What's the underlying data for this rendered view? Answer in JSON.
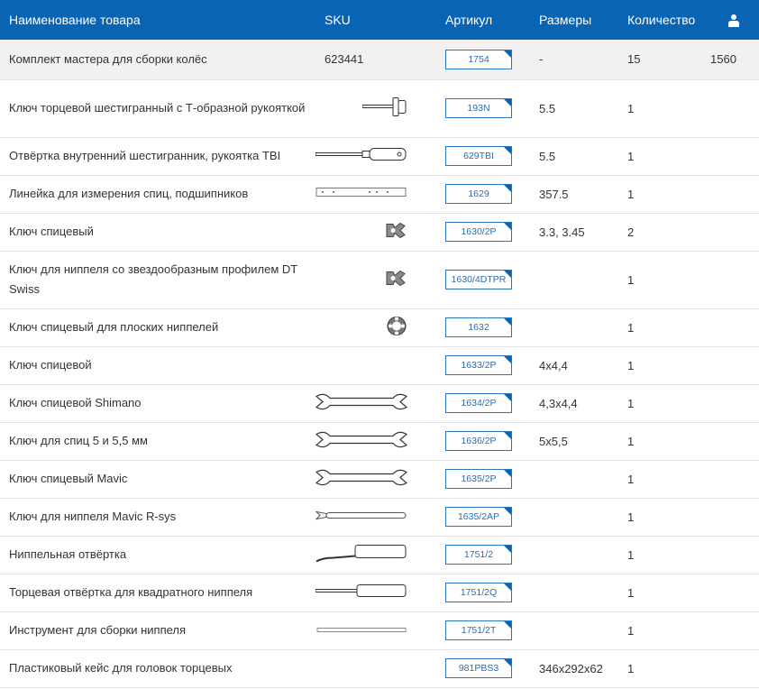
{
  "header": {
    "name": "Наименование товара",
    "sku": "SKU",
    "article": "Артикул",
    "size": "Размеры",
    "qty": "Количество",
    "user_icon": "user-icon"
  },
  "rows": [
    {
      "name": "Комплект мастера для сборки колёс",
      "sku": "623441",
      "article": "1754",
      "size": "-",
      "qty": "15",
      "extra": "1560",
      "image": ""
    },
    {
      "name": "Ключ торцевой шестигранный с Т-образной рукояткой",
      "sku": "",
      "article": "193N",
      "size": "5.5",
      "qty": "1",
      "extra": "",
      "image": "t-handle-hex-key"
    },
    {
      "name": "Отвёртка внутренний шестигранник, рукоятка TBI",
      "sku": "",
      "article": "629TBI",
      "size": "5.5",
      "qty": "1",
      "extra": "",
      "image": "hex-screwdriver"
    },
    {
      "name": "Линейка для измерения спиц, подшипников",
      "sku": "",
      "article": "1629",
      "size": "357.5",
      "qty": "1",
      "extra": "",
      "image": "spoke-ruler"
    },
    {
      "name": "Ключ спицевый",
      "sku": "",
      "article": "1630/2P",
      "size": "3.3, 3.45",
      "qty": "2",
      "extra": "",
      "image": "spoke-wrench"
    },
    {
      "name": "Ключ для ниппеля со звездообразным профилем DT Swiss",
      "sku": "",
      "article": "1630/4DTPR",
      "size": "",
      "qty": "1",
      "extra": "",
      "image": "spoke-wrench"
    },
    {
      "name": "Ключ спицевый для плоских ниппелей",
      "sku": "",
      "article": "1632",
      "size": "",
      "qty": "1",
      "extra": "",
      "image": "round-spoke-wrench"
    },
    {
      "name": "Ключ спицевой",
      "sku": "",
      "article": "1633/2P",
      "size": "4x4,4",
      "qty": "1",
      "extra": "",
      "image": ""
    },
    {
      "name": "Ключ спицевой Shimano",
      "sku": "",
      "article": "1634/2P",
      "size": "4,3x4,4",
      "qty": "1",
      "extra": "",
      "image": "double-end-wrench"
    },
    {
      "name": "Ключ для спиц 5 и 5,5 мм",
      "sku": "",
      "article": "1636/2P",
      "size": "5x5,5",
      "qty": "1",
      "extra": "",
      "image": "double-end-wrench"
    },
    {
      "name": "Ключ спицевый Mavic",
      "sku": "",
      "article": "1635/2P",
      "size": "",
      "qty": "1",
      "extra": "",
      "image": "double-end-wrench"
    },
    {
      "name": "Ключ для ниппеля Mavic R-sys",
      "sku": "",
      "article": "1635/2AP",
      "size": "",
      "qty": "1",
      "extra": "",
      "image": "long-key"
    },
    {
      "name": "Ниппельная отвёртка",
      "sku": "",
      "article": "1751/2",
      "size": "",
      "qty": "1",
      "extra": "",
      "image": "nipple-driver"
    },
    {
      "name": "Торцевая отвёртка для квадратного ниппеля",
      "sku": "",
      "article": "1751/2Q",
      "size": "",
      "qty": "1",
      "extra": "",
      "image": "screwdriver"
    },
    {
      "name": "Инструмент для сборки ниппеля",
      "sku": "",
      "article": "1751/2T",
      "size": "",
      "qty": "1",
      "extra": "",
      "image": "thin-rod"
    },
    {
      "name": "Пластиковый кейс для головок торцевых",
      "sku": "",
      "article": "981PBS3",
      "size": "346x292x62",
      "qty": "1",
      "extra": "",
      "image": ""
    }
  ],
  "colors": {
    "header_bg": "#0a64b4",
    "link": "#2a6cb3",
    "highlight_row": "#f1f1f1"
  }
}
